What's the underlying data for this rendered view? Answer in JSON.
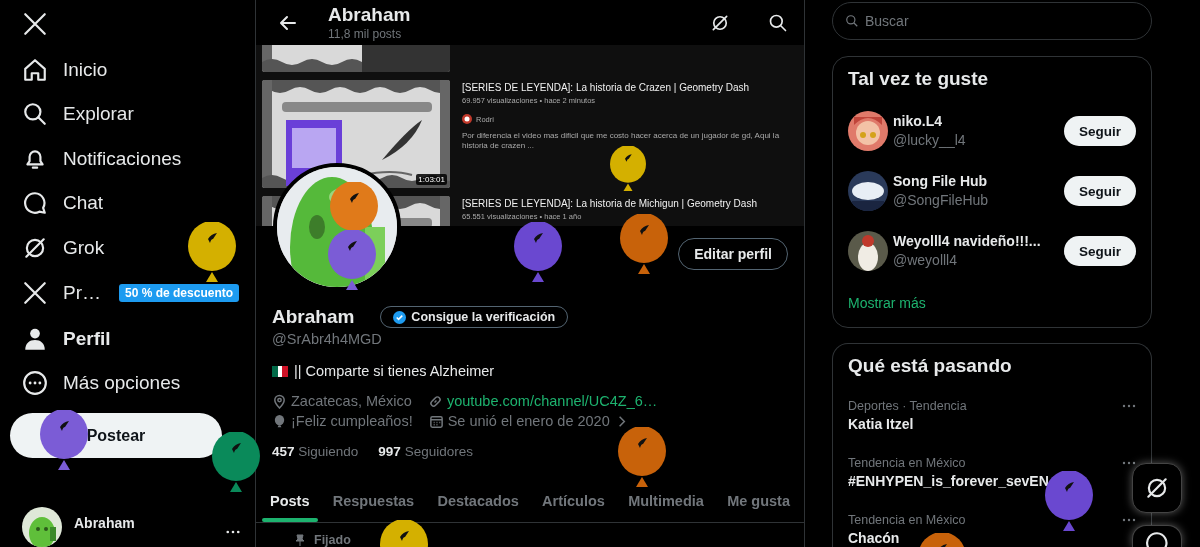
{
  "nav": {
    "items": [
      {
        "label": "Inicio",
        "selected": false
      },
      {
        "label": "Explorar",
        "selected": false
      },
      {
        "label": "Notificaciones",
        "selected": false
      },
      {
        "label": "Chat",
        "selected": false
      },
      {
        "label": "Grok",
        "selected": false
      },
      {
        "label": "Pr…",
        "selected": false,
        "badge": "50 % de descuento"
      },
      {
        "label": "Perfil",
        "selected": true
      },
      {
        "label": "Más opciones",
        "selected": false
      }
    ],
    "post_button": "Postear",
    "account": {
      "name": "Abraham"
    }
  },
  "header": {
    "title": "Abraham",
    "subtitle": "11,8 mil posts"
  },
  "banner": {
    "videos": [
      {
        "kind": "cut"
      },
      {
        "kind": "full",
        "title": "[SERIES DE LEYENDA]: La historia de Crazen | Geometry Dash",
        "meta": "69.957 visualizaciones • hace 2 minutos",
        "channel": "Rodri",
        "description": "Por diferencia el video mas dificil que me costo hacer acerca de un jugador de gd, Aqui la historia de crazen ...",
        "duration": "1:03:01"
      },
      {
        "kind": "full",
        "title": "[SERIES DE LEYENDA]: La historia de Michigun | Geometry Dash",
        "meta": "65.551 visualizaciones • hace 1 año"
      }
    ]
  },
  "profile": {
    "edit_button": "Editar perfil",
    "name": "Abraham",
    "verify_button": "Consigue la verificación",
    "handle": "@SrAbr4h4MGD",
    "bio": "|| Comparte si tienes Alzheimer",
    "location": "Zacatecas, México",
    "website": "youtube.com/channel/UC4Z_6…",
    "birthday": "¡Feliz cumpleaños!",
    "joined": "Se unió el enero de 2020",
    "following_count": "457",
    "following_label": "Siguiendo",
    "followers_count": "997",
    "followers_label": "Seguidores"
  },
  "tabs": [
    {
      "label": "Posts",
      "selected": true
    },
    {
      "label": "Respuestas",
      "selected": false
    },
    {
      "label": "Destacados",
      "selected": false
    },
    {
      "label": "Artículos",
      "selected": false
    },
    {
      "label": "Multimedia",
      "selected": false
    },
    {
      "label": "Me gusta",
      "selected": false
    }
  ],
  "pinned_label": "Fijado",
  "search": {
    "placeholder": "Buscar"
  },
  "suggestions": {
    "title": "Tal vez te guste",
    "users": [
      {
        "name": "niko.L4",
        "handle": "@lucky__l4",
        "button": "Seguir"
      },
      {
        "name": "Song File Hub",
        "handle": "@SongFileHub",
        "button": "Seguir"
      },
      {
        "name": "Weyolll4 navideño!!!...",
        "handle": "@weyolll4",
        "button": "Seguir"
      }
    ],
    "show_more": "Mostrar más"
  },
  "trends": {
    "title": "Qué está pasando",
    "items": [
      {
        "category": "Deportes · Tendencia",
        "name": "Katia Itzel"
      },
      {
        "category": "Tendencia en México",
        "name": "#ENHYPEN_is_forever_sevEN"
      },
      {
        "category": "Tendencia en México",
        "name": "Chacón"
      }
    ]
  }
}
